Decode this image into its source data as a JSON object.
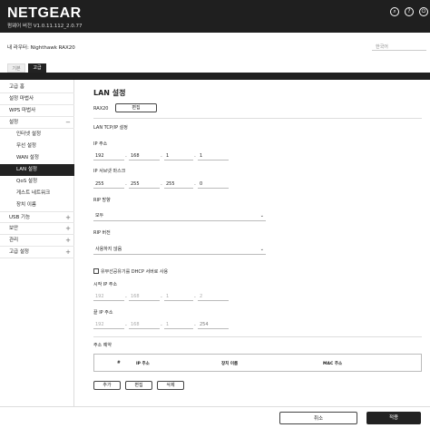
{
  "header": {
    "logo": "NETGEAR",
    "firmware": "펌웨어 버전 V1.0.11.112_2.0.77",
    "icons": [
      "search-icon",
      "help-icon",
      "logout-icon"
    ]
  },
  "router": {
    "name": "내 라우터: Nighthawk RAX20",
    "language": "한국어"
  },
  "tabs": {
    "basic": "기본",
    "advanced": "고급"
  },
  "sidebar": {
    "items": [
      {
        "label": "고급 홈"
      },
      {
        "label": "설정 마법사"
      },
      {
        "label": "WPS 마법사"
      },
      {
        "label": "설정",
        "toggle": "−"
      },
      {
        "label": "인터넷 설정"
      },
      {
        "label": "무선 설정"
      },
      {
        "label": "WAN 설정"
      },
      {
        "label": "LAN 설정"
      },
      {
        "label": "QoS 설정"
      },
      {
        "label": "게스트 네트워크"
      },
      {
        "label": "장치 이름"
      },
      {
        "label": "USB 기능",
        "toggle": "+"
      },
      {
        "label": "보안",
        "toggle": "+"
      },
      {
        "label": "관리",
        "toggle": "+"
      },
      {
        "label": "고급 설정",
        "toggle": "+"
      }
    ]
  },
  "main": {
    "title": "LAN 설정",
    "device": "RAX20",
    "edit_button": "편집",
    "lan_tcpip": "LAN TCP/IP 설정",
    "ip_label": "IP 주소",
    "ip": [
      "192",
      "168",
      "1",
      "1"
    ],
    "subnet_label": "IP 서브넷 마스크",
    "subnet": [
      "255",
      "255",
      "255",
      "0"
    ],
    "rip_dir_label": "RIP 방향",
    "rip_dir_value": "모두",
    "rip_ver_label": "RIP 버전",
    "rip_ver_value": "사용하지 않음",
    "dhcp_label": "유무선공유기를 DHCP 서버로 사용",
    "start_label": "시작 IP 주소",
    "start_ip": [
      "192",
      "168",
      "1",
      "2"
    ],
    "end_label": "끝 IP 주소",
    "end_ip": [
      "192",
      "168",
      "1",
      "254"
    ],
    "reserve_label": "주소 예약",
    "table_headers": [
      "#",
      "IP 주소",
      "장치 이름",
      "MAC 주소"
    ],
    "add_button": "추가",
    "edit2_button": "편집",
    "delete_button": "삭제"
  },
  "footer": {
    "cancel": "취소",
    "apply": "적용"
  }
}
